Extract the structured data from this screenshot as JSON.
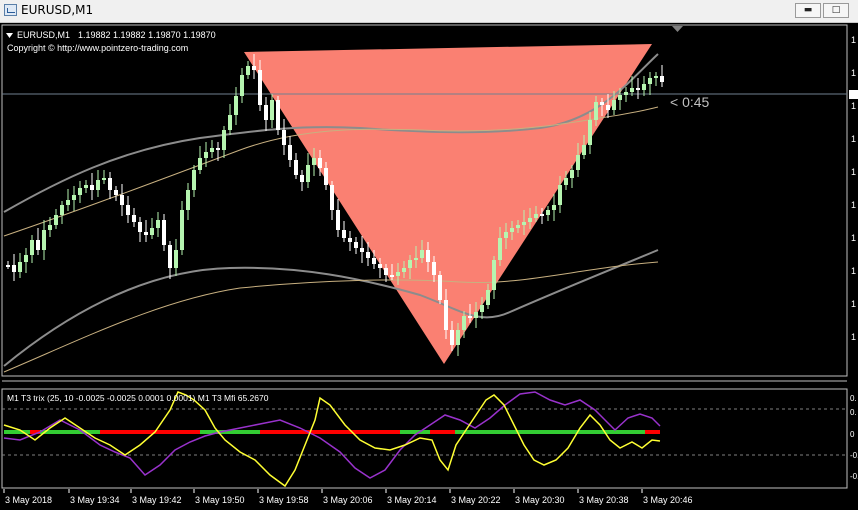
{
  "window": {
    "title": "EURUSD,M1",
    "buttons": [
      "minimize",
      "restore",
      "maximize"
    ]
  },
  "main_chart": {
    "header_symbol": "EURUSD,M1",
    "header_prices": "1.19882 1.19882 1.19870 1.19870",
    "copyright": "Copyright © http://www.pointzero-trading.com",
    "timer": "< 0:45"
  },
  "indicator_panel": {
    "label": "M1  T3 trix (25, 10 -0.0025 -0.0025 0.0001 0.0001)   M1  T3 Mfi  65.2670",
    "levels": [
      "0.",
      "0.",
      "0",
      "-0.",
      "-0."
    ]
  },
  "time_axis": [
    "3 May 2018",
    "3 May 19:34",
    "3 May 19:42",
    "3 May 19:50",
    "3 May 19:58",
    "3 May 20:06",
    "3 May 20:14",
    "3 May 20:22",
    "3 May 20:30",
    "3 May 20:38",
    "3 May 20:46"
  ],
  "price_axis_labels": [
    "1",
    "1",
    "1",
    "1",
    "1",
    "1",
    "1",
    "1",
    "1",
    "1"
  ],
  "colors": {
    "background": "#000000",
    "bull_candle": "#b6f5b0",
    "bear_candle": "#ffffff",
    "triangle": "#fa8072",
    "ma_gray": "#8c8c8c",
    "ma_tan": "#c8b080",
    "trix_line": "#ffff33",
    "mfi_line": "#9932cc",
    "signal_green": "#33cc33",
    "signal_red": "#ff0000"
  }
}
